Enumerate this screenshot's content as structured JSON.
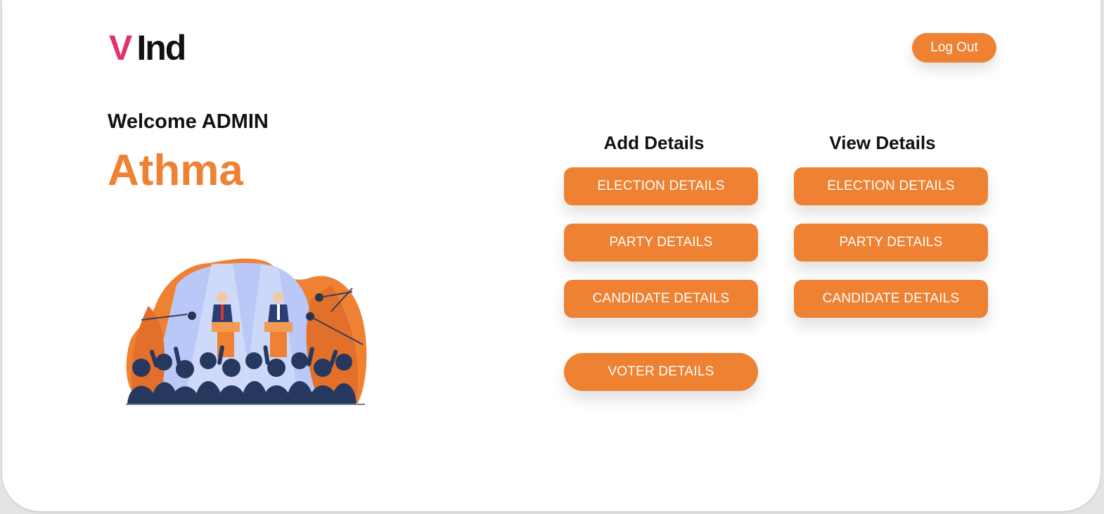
{
  "colors": {
    "accent": "#ee8132",
    "logo_v": "#e0336b"
  },
  "header": {
    "logo_v": "V",
    "logo_rest": "Ind",
    "logout_label": "Log Out"
  },
  "welcome": {
    "greeting": "Welcome ADMIN",
    "name": "Athma"
  },
  "illustration": {
    "icon": "election-debate-illustration"
  },
  "add_details": {
    "title": "Add Details",
    "buttons": [
      "ELECTION DETAILS",
      "PARTY DETAILS",
      "CANDIDATE DETAILS",
      "VOTER DETAILS"
    ]
  },
  "view_details": {
    "title": "View Details",
    "buttons": [
      "ELECTION DETAILS",
      "PARTY DETAILS",
      "CANDIDATE DETAILS"
    ]
  }
}
